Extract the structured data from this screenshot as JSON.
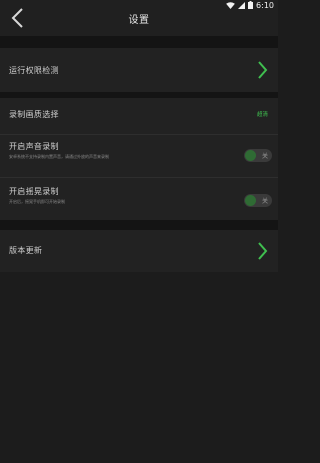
{
  "status_bar": {
    "time": "6:10"
  },
  "header": {
    "title": "设置"
  },
  "settings": {
    "permission_check": {
      "label": "运行权限检测"
    },
    "quality": {
      "label": "录制画质选择",
      "value": "超清"
    },
    "audio": {
      "label": "开启声音录制",
      "description": "安卓系统不支持录制内置声音，请通过外放的声音来录制",
      "toggle_text": "关"
    },
    "floating": {
      "label": "开启摇晃录制",
      "description": "开启后，摇晃手机即可开始录制",
      "toggle_text": "关"
    },
    "version": {
      "label": "版本更新"
    }
  },
  "colors": {
    "accent": "#3fbf4f",
    "background": "#1c1c1c",
    "row": "#222222"
  }
}
